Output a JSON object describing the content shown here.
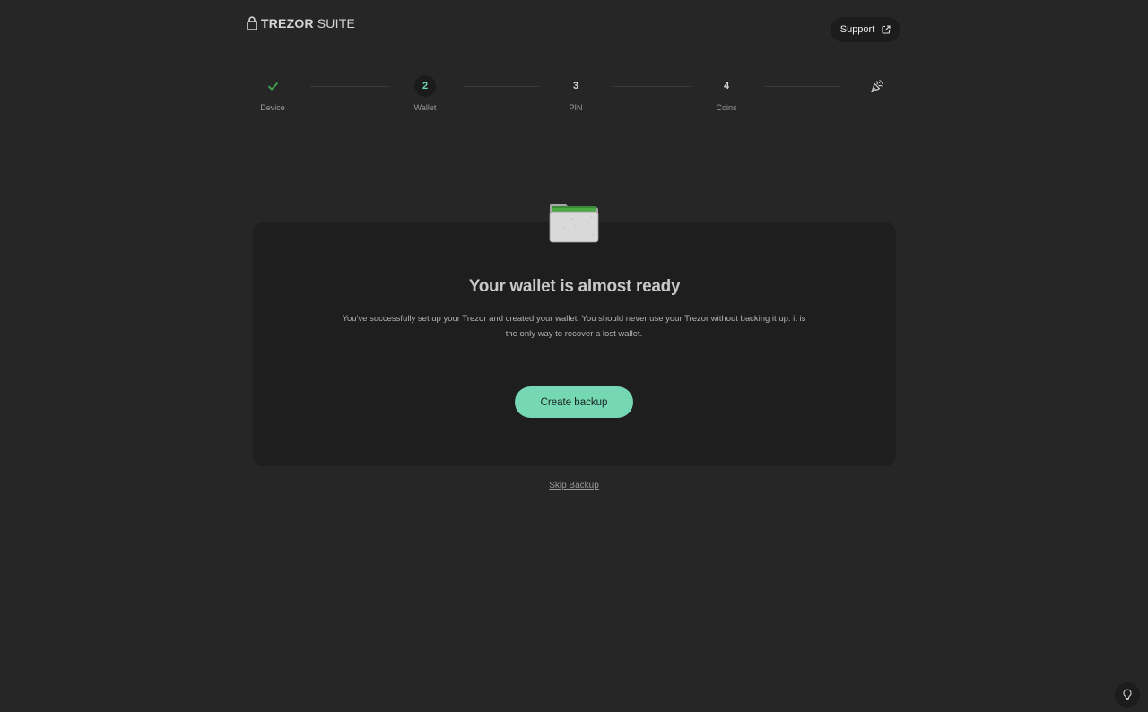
{
  "header": {
    "brand_strong": "TREZOR",
    "brand_light": "SUITE",
    "support_label": "Support",
    "icons": {
      "logo": "lock-icon",
      "support": "external-link-icon"
    }
  },
  "stepper": {
    "steps": [
      {
        "number": "",
        "label": "Device",
        "status": "done",
        "icon": "check-icon"
      },
      {
        "number": "2",
        "label": "Wallet",
        "status": "active"
      },
      {
        "number": "3",
        "label": "PIN",
        "status": "upcoming"
      },
      {
        "number": "4",
        "label": "Coins",
        "status": "upcoming"
      },
      {
        "number": "",
        "label": "",
        "status": "final",
        "icon": "party-popper-icon"
      }
    ]
  },
  "card": {
    "title": "Your wallet is almost ready",
    "description": "You've successfully set up your Trezor and created your wallet. You should never use your Trezor without backing it up: it is the only way to recover a lost wallet.",
    "primary_button": "Create backup",
    "icon": "folder-icon"
  },
  "skip_link": "Skip Backup",
  "tips": {
    "icon": "lightbulb-icon"
  },
  "colors": {
    "background": "#262626",
    "card": "#1e1e1e",
    "accent": "#76d7b5",
    "check": "#3ea04d"
  }
}
